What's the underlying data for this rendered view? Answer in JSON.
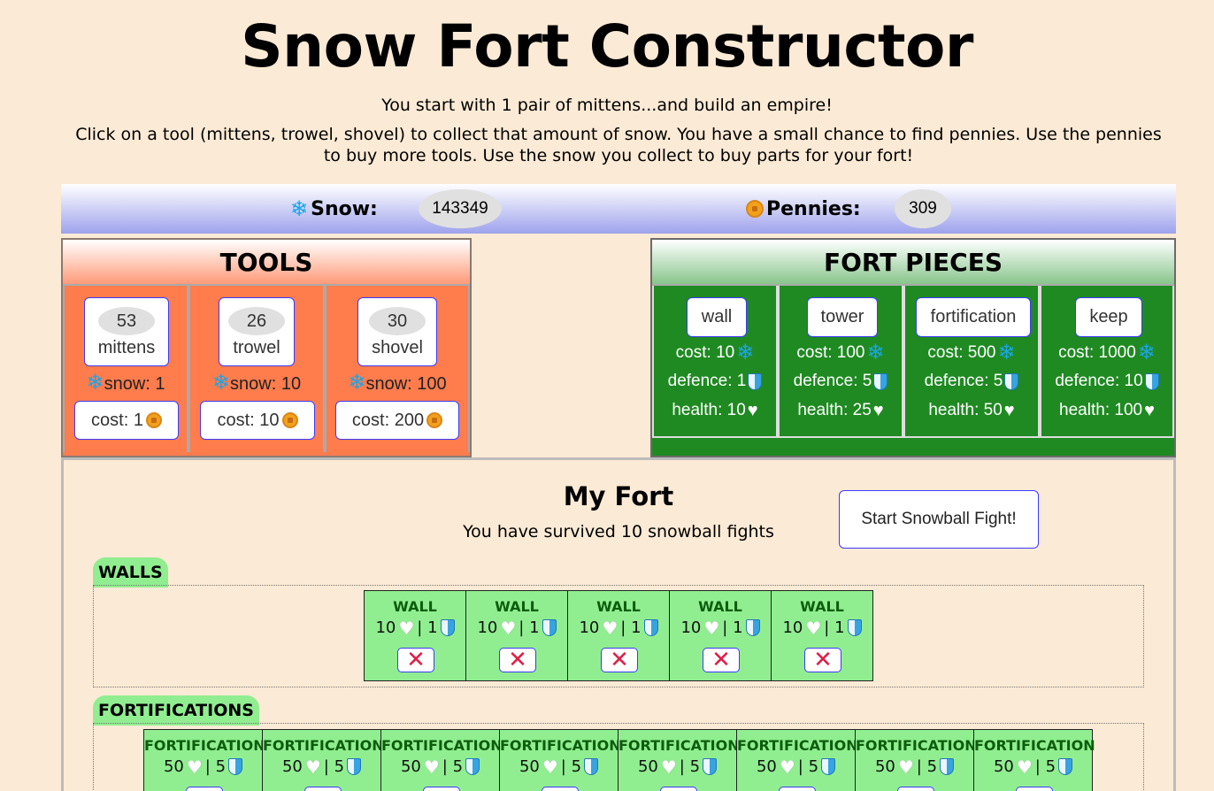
{
  "title": "Snow Fort Constructor",
  "intro_line1": "You start with 1 pair of mittens...and build an empire!",
  "intro_line2": "Click on a tool (mittens, trowel, shovel) to collect that amount of snow. You have a small chance to find pennies. Use the pennies to buy more tools. Use the snow you collect to buy parts for your fort!",
  "stats": {
    "snow_label": "Snow:",
    "snow_value": "143349",
    "pennies_label": "Pennies:",
    "pennies_value": "309"
  },
  "tools": {
    "heading": "TOOLS",
    "items": [
      {
        "count": "53",
        "name": "mittens",
        "snow": "snow: 1",
        "cost": "cost: 1"
      },
      {
        "count": "26",
        "name": "trowel",
        "snow": "snow: 10",
        "cost": "cost: 10"
      },
      {
        "count": "30",
        "name": "shovel",
        "snow": "snow: 100",
        "cost": "cost: 200"
      }
    ]
  },
  "pieces": {
    "heading": "FORT PIECES",
    "items": [
      {
        "name": "wall",
        "cost": "cost: 10",
        "defence": "defence: 1",
        "health": "health: 10"
      },
      {
        "name": "tower",
        "cost": "cost: 100",
        "defence": "defence: 5",
        "health": "health: 25"
      },
      {
        "name": "fortification",
        "cost": "cost: 500",
        "defence": "defence: 5",
        "health": "health: 50"
      },
      {
        "name": "keep",
        "cost": "cost: 1000",
        "defence": "defence: 10",
        "health": "health: 100"
      }
    ]
  },
  "my_fort": {
    "title": "My Fort",
    "survived": "You have survived 10 snowball fights",
    "start_button": "Start Snowball Fight!",
    "walls": {
      "label": "WALLS",
      "block_title": "WALL",
      "health": "10",
      "defence": "| 1",
      "count": 5
    },
    "fortifications": {
      "label": "FORTIFICATIONS",
      "block_title": "FORTIFICATION",
      "health": "50",
      "defence": "| 5",
      "count": 8
    },
    "delete_glyph": "✕"
  },
  "icons": {
    "snow": "snowflake-icon",
    "pennies": "coin-icon",
    "defence": "shield-icon",
    "health": "heart-icon",
    "delete": "red-x-icon"
  },
  "colors": {
    "background": "#fbead5",
    "tools_panel": "#ff7c4d",
    "pieces_panel": "#1f8a22",
    "fort_block": "#90ee90",
    "button_border": "#3a3aff",
    "delete_x": "#e01e46"
  }
}
